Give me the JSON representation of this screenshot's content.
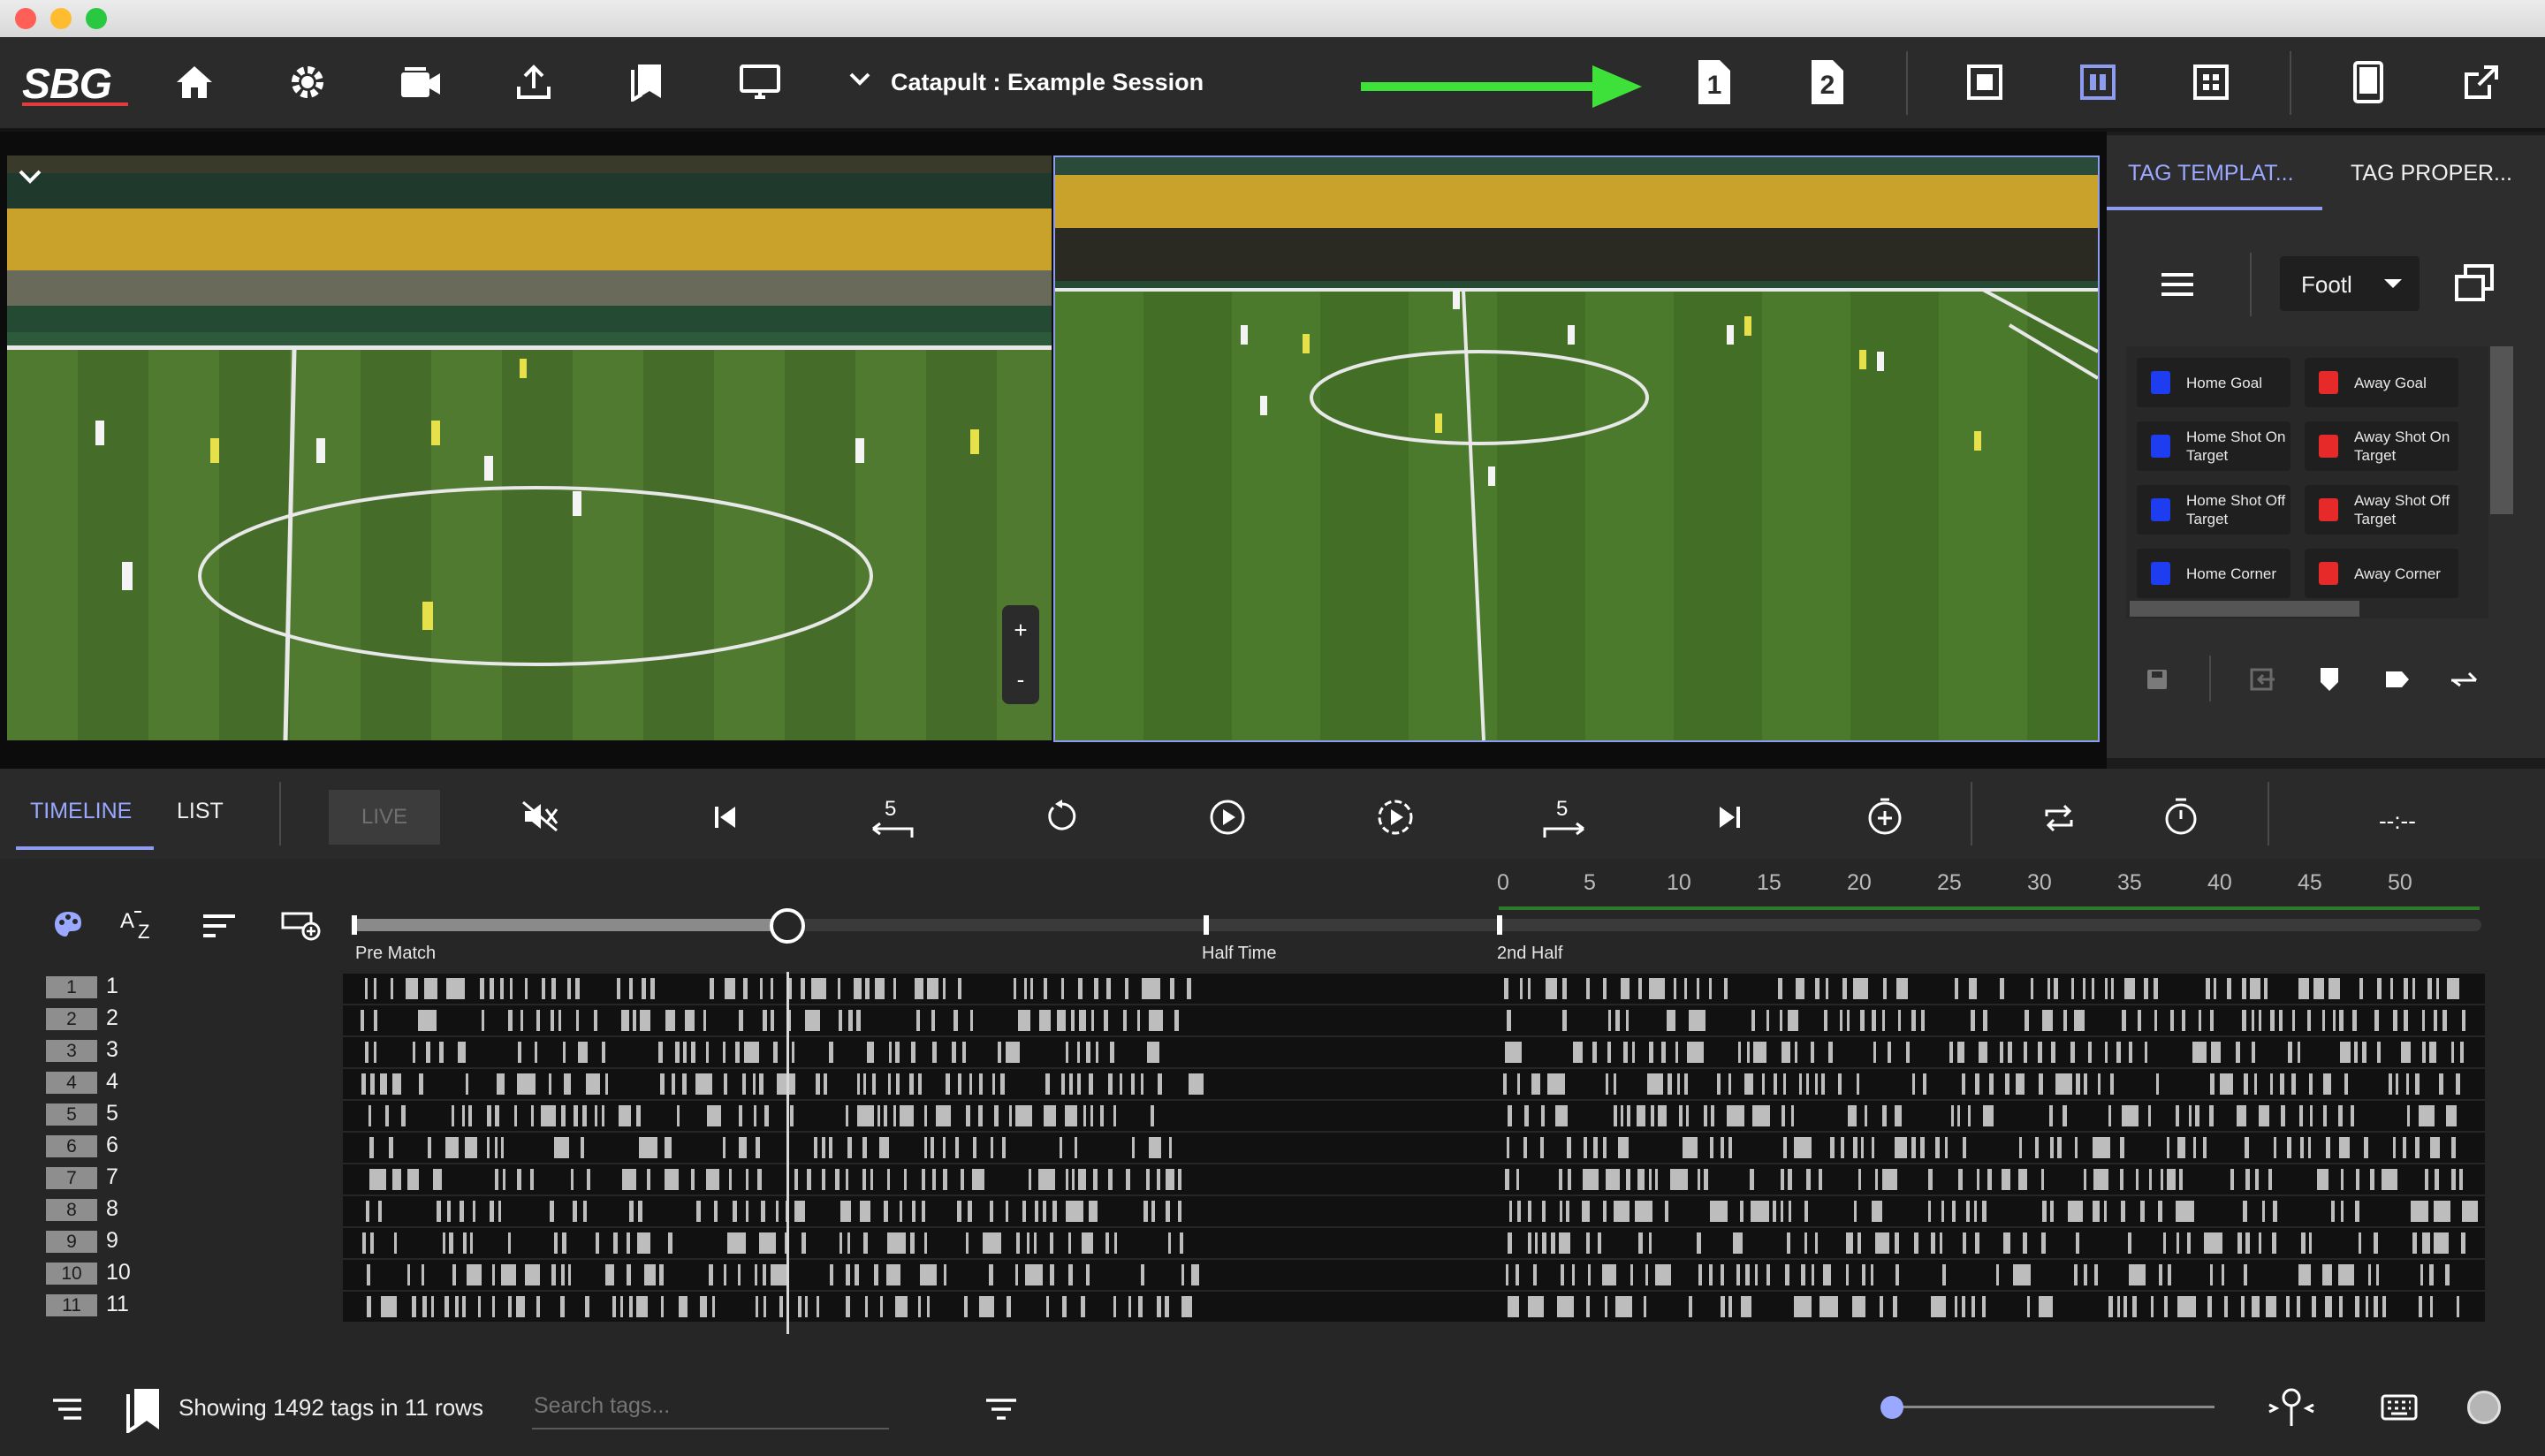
{
  "app": {
    "logo": "SBG",
    "session_title": "Catapult : Example Session"
  },
  "toolbar": {
    "icons": [
      "home-icon",
      "gear-icon",
      "camera-icon",
      "upload-icon",
      "bookmarks-icon",
      "monitor-icon"
    ],
    "view_buttons": [
      "view-1-icon",
      "view-2-icon",
      "layout-single-icon",
      "layout-split-icon",
      "layout-grid-icon",
      "tablet-icon",
      "external-window-icon"
    ],
    "arrow_color": "#3ee03a"
  },
  "video": {
    "zoom_in": "+",
    "zoom_out": "-"
  },
  "right_panel": {
    "tabs": [
      "TAG TEMPLAT...",
      "TAG PROPER..."
    ],
    "template_select": "Footl",
    "tags": [
      {
        "label": "Home Goal",
        "color": "#1e3cf0"
      },
      {
        "label": "Away Goal",
        "color": "#e62a2a"
      },
      {
        "label": "Home Shot On Target",
        "color": "#1e3cf0"
      },
      {
        "label": "Away Shot On Target",
        "color": "#e62a2a"
      },
      {
        "label": "Home Shot Off Target",
        "color": "#1e3cf0"
      },
      {
        "label": "Away Shot Off Target",
        "color": "#e62a2a"
      },
      {
        "label": "Home Corner",
        "color": "#1e3cf0"
      },
      {
        "label": "Away Corner",
        "color": "#e62a2a"
      }
    ]
  },
  "controls": {
    "tabs": [
      "TIMELINE",
      "LIST"
    ],
    "live": "LIVE",
    "skip_back": "5",
    "skip_forward": "5",
    "time": "--:--"
  },
  "timeline": {
    "ruler": [
      "0",
      "5",
      "10",
      "15",
      "20",
      "25",
      "30",
      "35",
      "40",
      "45",
      "50"
    ],
    "markers": [
      "Pre Match",
      "Half Time",
      "2nd Half"
    ],
    "playhead": 0.2,
    "rows": [
      "1",
      "2",
      "3",
      "4",
      "5",
      "6",
      "7",
      "8",
      "9",
      "10",
      "11"
    ]
  },
  "footer": {
    "status": "Showing 1492 tags in 11 rows",
    "search_placeholder": "Search tags...",
    "zoom": 0.0
  }
}
